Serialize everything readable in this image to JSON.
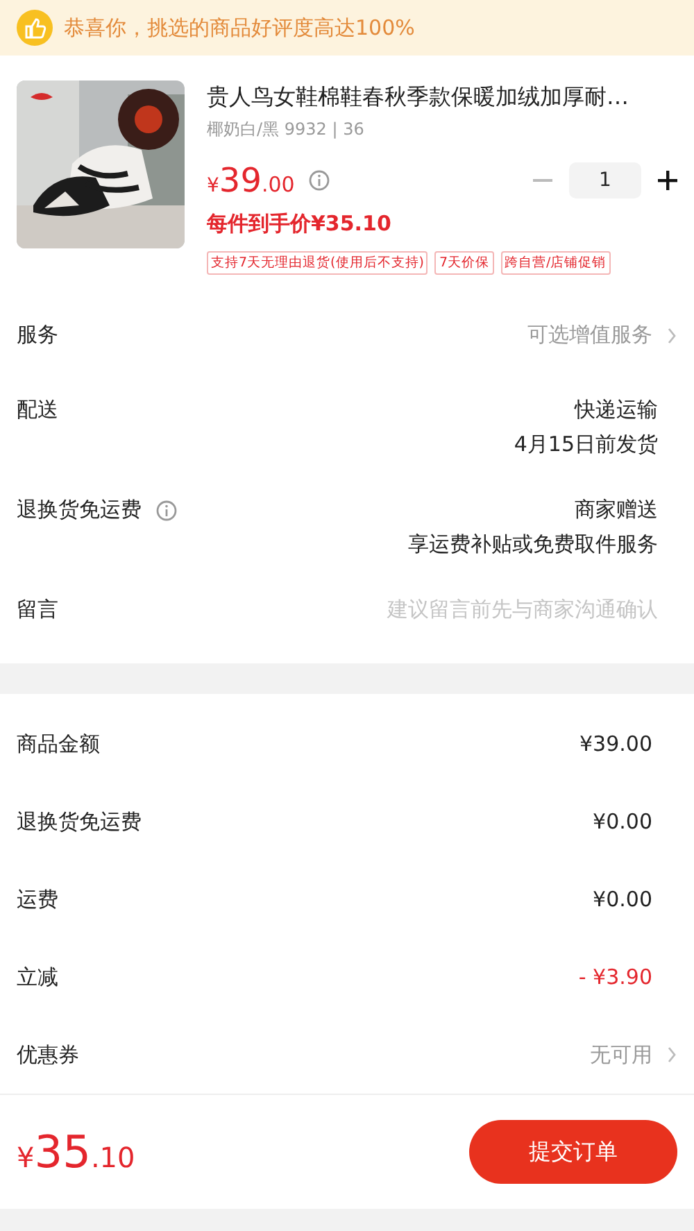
{
  "banner": {
    "text": "恭喜你，挑选的商品好评度高达100%"
  },
  "product": {
    "title": "贵人鸟女鞋棉鞋春秋季款保暖加绒加厚耐…",
    "spec": "椰奶白/黑 9932 | 36",
    "price_symbol": "¥",
    "price_int": "39",
    "price_dec": ".00",
    "final_price": "每件到手价¥35.10",
    "quantity": "1",
    "tags": [
      "支持7天无理由退货(使用后不支持)",
      "7天价保",
      "跨自营/店铺促销"
    ]
  },
  "options": [
    {
      "kind": "select",
      "label": "服务",
      "info": false,
      "values": [
        "可选增值服务"
      ]
    },
    {
      "kind": "text",
      "label": "配送",
      "info": false,
      "values": [
        "快递运输",
        "4月15日前发货"
      ]
    },
    {
      "kind": "text",
      "label": "退换货免运费",
      "info": true,
      "values": [
        "商家赠送",
        "享运费补贴或免费取件服务"
      ]
    },
    {
      "kind": "input",
      "label": "留言",
      "info": false,
      "placeholder": "建议留言前先与商家沟通确认"
    }
  ],
  "summary": [
    {
      "label": "商品金额",
      "value": "¥39.00",
      "kind": "plain"
    },
    {
      "label": "退换货免运费",
      "value": "¥0.00",
      "kind": "plain"
    },
    {
      "label": "运费",
      "value": "¥0.00",
      "kind": "plain"
    },
    {
      "label": "立减",
      "value": "- ¥3.90",
      "kind": "discount"
    },
    {
      "label": "优惠券",
      "value": "无可用",
      "kind": "link"
    }
  ],
  "footer": {
    "symbol": "¥",
    "int": "35",
    "dec": ".10",
    "button": "提交订单"
  }
}
